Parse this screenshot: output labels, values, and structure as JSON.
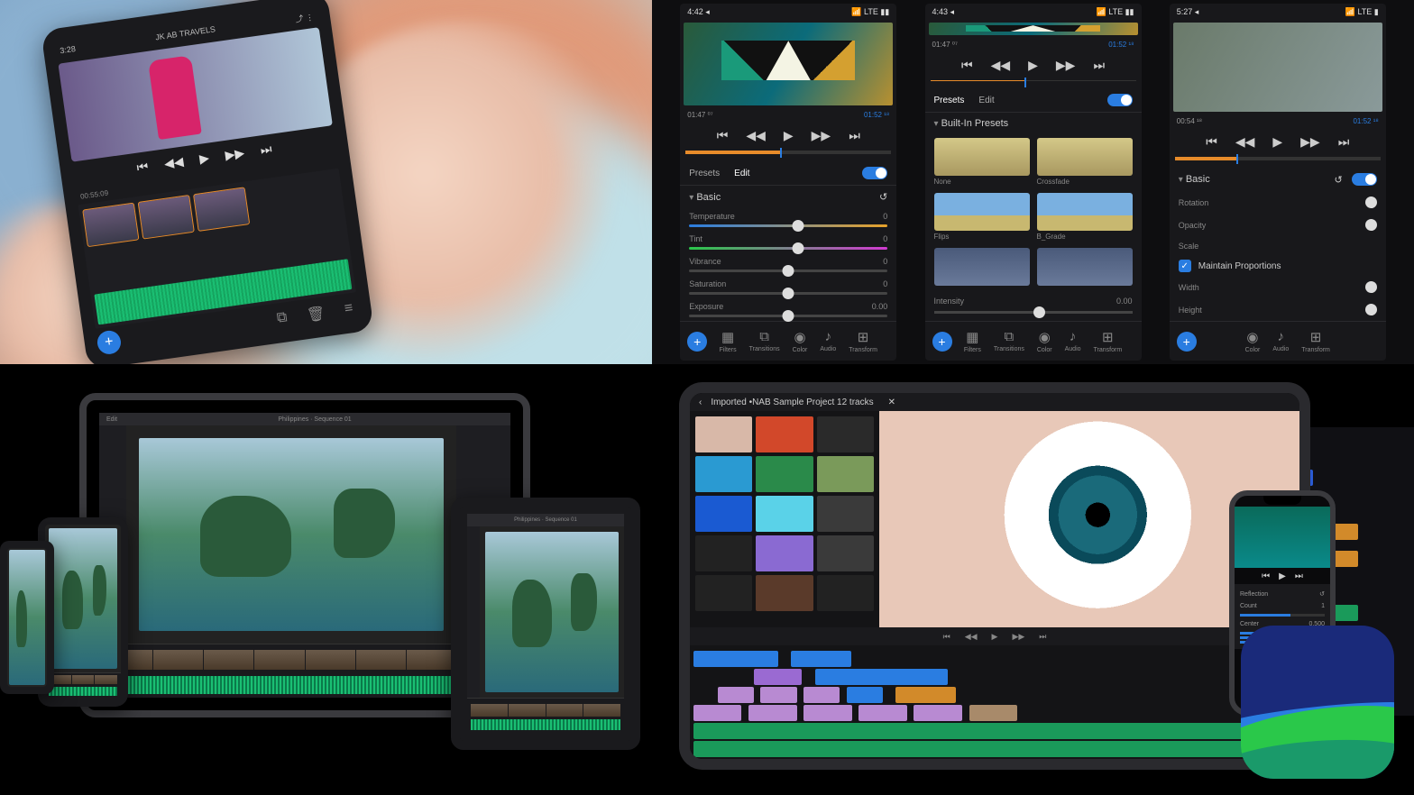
{
  "q1": {
    "time": "3:28",
    "project": "JK AB TRAVELS",
    "timecode": "00:55:09",
    "playback": {
      "start": "⏮",
      "prev": "◀◀",
      "play": "▶",
      "next": "▶▶",
      "end": "⏭"
    },
    "bottom_icons": {
      "copy": "⧉",
      "trash": "🗑",
      "menu": "≡"
    },
    "add": "+"
  },
  "q2": {
    "panels": [
      {
        "status": {
          "time": "4:42 ◂",
          "right": "📶 LTE ▮▮"
        },
        "tc_left": "01:47 ⁰⁷",
        "tc_right": "01:52 ¹⁸",
        "tabs": {
          "presets": "Presets",
          "edit": "Edit"
        },
        "section": "Basic",
        "sliders": [
          {
            "label": "Temperature",
            "value": "0",
            "gradient": "linear-gradient(90deg,#2a7de1,#e7a22a)",
            "thumb": 55
          },
          {
            "label": "Tint",
            "value": "0",
            "gradient": "linear-gradient(90deg,#2ac84a,#d23ad2)",
            "thumb": 55
          },
          {
            "label": "Vibrance",
            "value": "0",
            "gradient": "#444",
            "thumb": 50
          },
          {
            "label": "Saturation",
            "value": "0",
            "gradient": "#444",
            "thumb": 50
          },
          {
            "label": "Exposure",
            "value": "0.00",
            "gradient": "#444",
            "thumb": 50
          }
        ],
        "tools": [
          "Filters",
          "Transitions",
          "Color",
          "Audio",
          "Transform"
        ]
      },
      {
        "status": {
          "time": "4:43 ◂",
          "right": "📶 LTE ▮▮"
        },
        "tc_left": "01:47 ⁰⁷",
        "tc_right": "01:52 ¹⁸",
        "tabs": {
          "presets": "Presets",
          "edit": "Edit"
        },
        "section": "Built-In Presets",
        "preset_items": [
          {
            "label": "None"
          },
          {
            "label": "Crossfade"
          },
          {
            "label": "Flips"
          },
          {
            "label": "B_Grade"
          },
          {
            "label": ""
          },
          {
            "label": ""
          }
        ],
        "intensity": {
          "label": "Intensity",
          "value": "0.00"
        },
        "tools": [
          "Filters",
          "Transitions",
          "Color",
          "Audio",
          "Transform"
        ]
      },
      {
        "status": {
          "time": "5:27 ◂",
          "right": "📶 LTE ▮"
        },
        "tc_left": "00:54 ¹⁸",
        "tc_right": "01:52 ¹⁸",
        "section": "Basic",
        "rows": [
          {
            "label": "Rotation"
          },
          {
            "label": "Opacity"
          }
        ],
        "scale_label": "Scale",
        "maintain": "Maintain Proportions",
        "dims": [
          {
            "label": "Width"
          },
          {
            "label": "Height"
          }
        ],
        "tools": [
          "Color",
          "Audio",
          "Transform"
        ]
      }
    ],
    "playback": {
      "start": "⏮",
      "prev": "◀◀",
      "play": "▶",
      "next": "▶▶",
      "end": "⏭"
    },
    "add": "+",
    "reset_icon": "↺"
  },
  "q3": {
    "menubar_item1": "Edit",
    "title": "Philippines · Sequence 01"
  },
  "q4": {
    "project": "Imported •NAB Sample Project 12 tracks",
    "iphone": {
      "section": "Reflection",
      "rows": [
        {
          "label": "Count",
          "value": "1"
        },
        {
          "label": "Center",
          "value": "0.500"
        },
        {
          "label": "",
          "value": ""
        }
      ]
    },
    "playback": {
      "start": "⏮",
      "prev": "◀◀",
      "play": "▶",
      "next": "▶▶",
      "end": "⏭"
    }
  }
}
